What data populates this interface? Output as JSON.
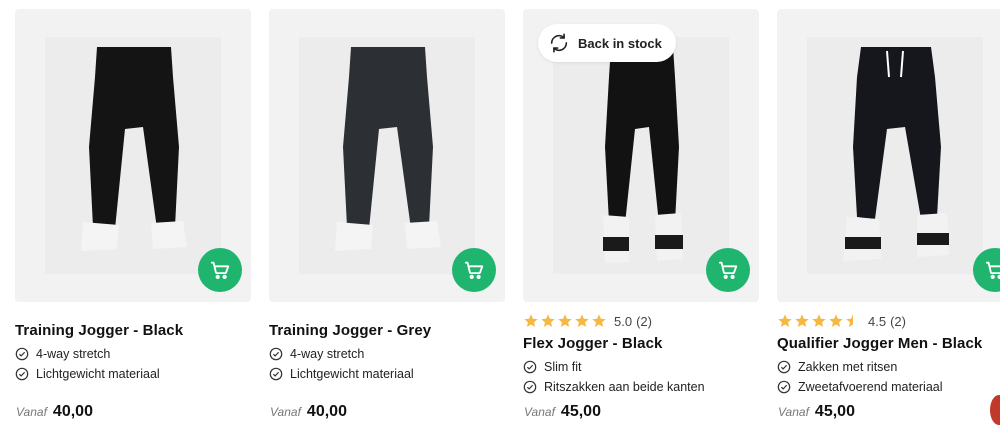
{
  "products": [
    {
      "title": "Training Jogger - Black",
      "features": [
        "4-way stretch",
        "Lichtgewicht materiaal"
      ],
      "price_label": "Vanaf",
      "price": "40,00",
      "pant_color": "#141414"
    },
    {
      "title": "Training Jogger - Grey",
      "features": [
        "4-way stretch",
        "Lichtgewicht materiaal"
      ],
      "price_label": "Vanaf",
      "price": "40,00",
      "pant_color": "#2c3034"
    },
    {
      "title": "Flex Jogger - Black",
      "badge": "Back in stock",
      "rating": "5.0",
      "reviews": "(2)",
      "features": [
        "Slim fit",
        "Ritszakken aan beide kanten"
      ],
      "price_label": "Vanaf",
      "price": "45,00",
      "pant_color": "#121212"
    },
    {
      "title": "Qualifier Jogger Men - Black",
      "rating": "4.5",
      "reviews": "(2)",
      "features": [
        "Zakken met ritsen",
        "Zweetafvoerend materiaal"
      ],
      "price_label": "Vanaf",
      "price": "45,00",
      "pant_color": "#15171c"
    }
  ],
  "colors": {
    "accent": "#1fb56f",
    "star": "#f5b942",
    "card_bg": "#f2f2f2"
  },
  "icons": {
    "cart": "cart-icon",
    "check": "check-circle-icon",
    "refresh": "refresh-icon",
    "star": "star-icon"
  }
}
